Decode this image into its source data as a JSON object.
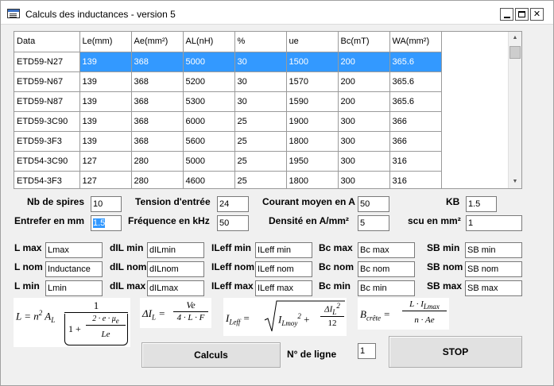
{
  "window": {
    "title": "Calculs des inductances - version 5",
    "controls": {
      "minimize": "",
      "maximize": "",
      "close": "✕"
    }
  },
  "grid": {
    "headers": [
      "Data",
      "Le(mm)",
      "Ae(mm²)",
      "AL(nH)",
      "%",
      "ue",
      "Bc(mT)",
      "WA(mm²)"
    ],
    "rows": [
      [
        "ETD59-N27",
        "139",
        "368",
        "5000",
        "30",
        "1500",
        "200",
        "365.6"
      ],
      [
        "ETD59-N67",
        "139",
        "368",
        "5200",
        "30",
        "1570",
        "200",
        "365.6"
      ],
      [
        "ETD59-N87",
        "139",
        "368",
        "5300",
        "30",
        "1590",
        "200",
        "365.6"
      ],
      [
        "ETD59-3C90",
        "139",
        "368",
        "6000",
        "25",
        "1900",
        "300",
        "366"
      ],
      [
        "ETD59-3F3",
        "139",
        "368",
        "5600",
        "25",
        "1800",
        "300",
        "366"
      ],
      [
        "ETD54-3C90",
        "127",
        "280",
        "5000",
        "25",
        "1950",
        "300",
        "316"
      ],
      [
        "ETD54-3F3",
        "127",
        "280",
        "4600",
        "25",
        "1800",
        "300",
        "316"
      ]
    ],
    "selected_row": 0,
    "scroll_up": "▲",
    "scroll_down": "▼"
  },
  "params": {
    "nb_spires": {
      "label": "Nb de spires",
      "value": "10"
    },
    "tension": {
      "label": "Tension d'entrée",
      "value": "24"
    },
    "courant": {
      "label": "Courant moyen en A",
      "value": "50"
    },
    "kb": {
      "label": "KB",
      "value": "1.5"
    },
    "entrefer": {
      "label": "Entrefer en mm",
      "value": "1.5"
    },
    "frequence": {
      "label": "Fréquence en kHz",
      "value": "50"
    },
    "densite": {
      "label": "Densité en A/mm²",
      "value": "5"
    },
    "scu": {
      "label": "scu en mm²",
      "value": "1"
    }
  },
  "results": {
    "lmax": {
      "label": "L max",
      "value": "Lmax"
    },
    "lnom": {
      "label": "L nom",
      "value": "Inductance"
    },
    "lmin": {
      "label": "L min",
      "value": "Lmin"
    },
    "dilmin": {
      "label": "dIL min",
      "value": "dILmin"
    },
    "dilnom": {
      "label": "dIL nom",
      "value": "dILnom"
    },
    "dilmax": {
      "label": "dIL max",
      "value": "dILmax"
    },
    "ileffmin": {
      "label": "ILeff min",
      "value": "ILeff min"
    },
    "ileffnom": {
      "label": "ILeff nom",
      "value": "ILeff nom"
    },
    "ileffmax": {
      "label": "ILeff max",
      "value": "ILeff max"
    },
    "bcmax": {
      "label": "Bc max",
      "value": "Bc max"
    },
    "bcnom": {
      "label": "Bc nom",
      "value": "Bc nom"
    },
    "bcmin": {
      "label": "Bc min",
      "value": "Bc min"
    },
    "sbmin": {
      "label": "SB min",
      "value": "SB min"
    },
    "sbnom": {
      "label": "SB nom",
      "value": "SB nom"
    },
    "sbmax": {
      "label": "SB max",
      "value": "SB max"
    }
  },
  "formulas": {
    "f1": {
      "lhs": "L = n",
      "exp": "2",
      "al": " A",
      "al_sub": "L",
      "num": "1",
      "den_pre": "1 + ",
      "den_num": "2 · e · μ",
      "den_num_sub": "e",
      "den_den": "Le"
    },
    "f2": {
      "lhs": "ΔI",
      "lhs_sub": "L",
      "eq": " = ",
      "num": "Ve",
      "den": "4 · L · F"
    },
    "f3": {
      "lhs": "I",
      "lhs_sub": "Leff",
      "eq": " = ",
      "rad_a": "I",
      "rad_a_sub": "Lmoy",
      "rad_a_sup": "2",
      "plus": " + ",
      "num": "ΔI",
      "num_sub": "L",
      "num_sup": "2",
      "den": "12"
    },
    "f4": {
      "lhs": "B",
      "lhs_sub": "crête",
      "eq": " = ",
      "num": "L · I",
      "num_sub": "Lmax",
      "den": "n · Ae"
    }
  },
  "actions": {
    "calculs": "Calculs",
    "ligne_label": "N° de ligne",
    "ligne_value": "1",
    "stop": "STOP"
  }
}
